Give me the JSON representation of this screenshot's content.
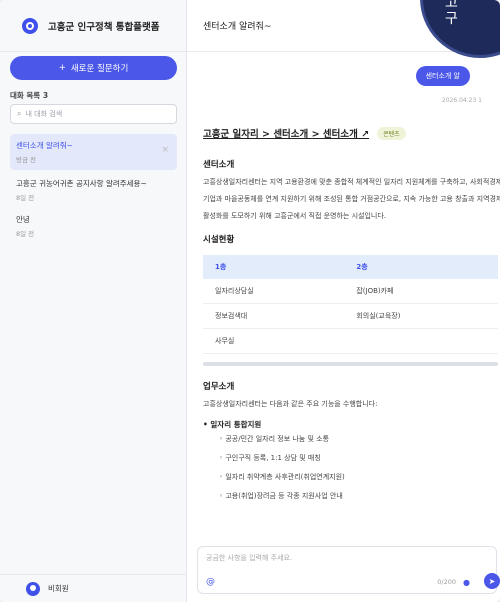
{
  "sidebar": {
    "title": "고흥군 인구정책 통합플랫폼",
    "new_button": "새로운 질문하기",
    "new_icon": "+",
    "list_label": "대화 목록 3",
    "search_placeholder": "내 대화 검색",
    "conversations": [
      {
        "title": "센터소개 알려줘~",
        "date": "방금 전"
      },
      {
        "title": "고흥군 귀농어귀촌 공지사항 알려주세용~",
        "date": "8일 전"
      },
      {
        "title": "안녕",
        "date": "8일 전"
      }
    ],
    "user": "비회원"
  },
  "header": {
    "title": "센터소개 알려줘~"
  },
  "overlay": {
    "text": "고\n구"
  },
  "chat": {
    "user_message": "센터소개 알",
    "timestamp": "2026.04.23 1",
    "breadcrumb": "고흥군 일자리 > 센터소개 > 센터소개 ↗",
    "tag": "콘텐츠",
    "section1_title": "센터소개",
    "section1_body": "고흥상생일자리센터는 지역 고용환경에 맞춘 종합적 체계적인 일자리 지원체계를 구축하고, 사회적경제기업과 마을공동체를 연계 지원하기 위해 조성된 통합 거점공간으로, 지속 가능한 고용 창출과 지역경제 활성화를 도모하기 위해 고흥군에서 직접 운영하는 시설입니다.",
    "section2_title": "시설현황",
    "table": {
      "headers": [
        "1층",
        "2층"
      ],
      "rows": [
        [
          "일자리상담실",
          "잡(JOB)카페"
        ],
        [
          "정보검색대",
          "회의실(교육장)"
        ],
        [
          "사무실",
          ""
        ]
      ]
    },
    "section3_title": "업무소개",
    "section3_intro": "고흥상생일자리센터는 다음과 같은 주요 기능을 수행합니다:",
    "bullet_main": "일자리 통합지원",
    "bullet_items": [
      "공공/민간 일자리 정보 나눔 및 소통",
      "구인구직 등록, 1:1 상담 및 매칭",
      "일자리 취약계층 사후관리(취업연계지원)",
      "고용(취업)장려금 등 각종 지원사업 안내"
    ]
  },
  "composer": {
    "placeholder": "궁금한 사항을 입력해 주세요.",
    "counter": "0/200"
  },
  "colors": {
    "accent": "#4a57e8",
    "dark_overlay": "#1e2a5a"
  }
}
